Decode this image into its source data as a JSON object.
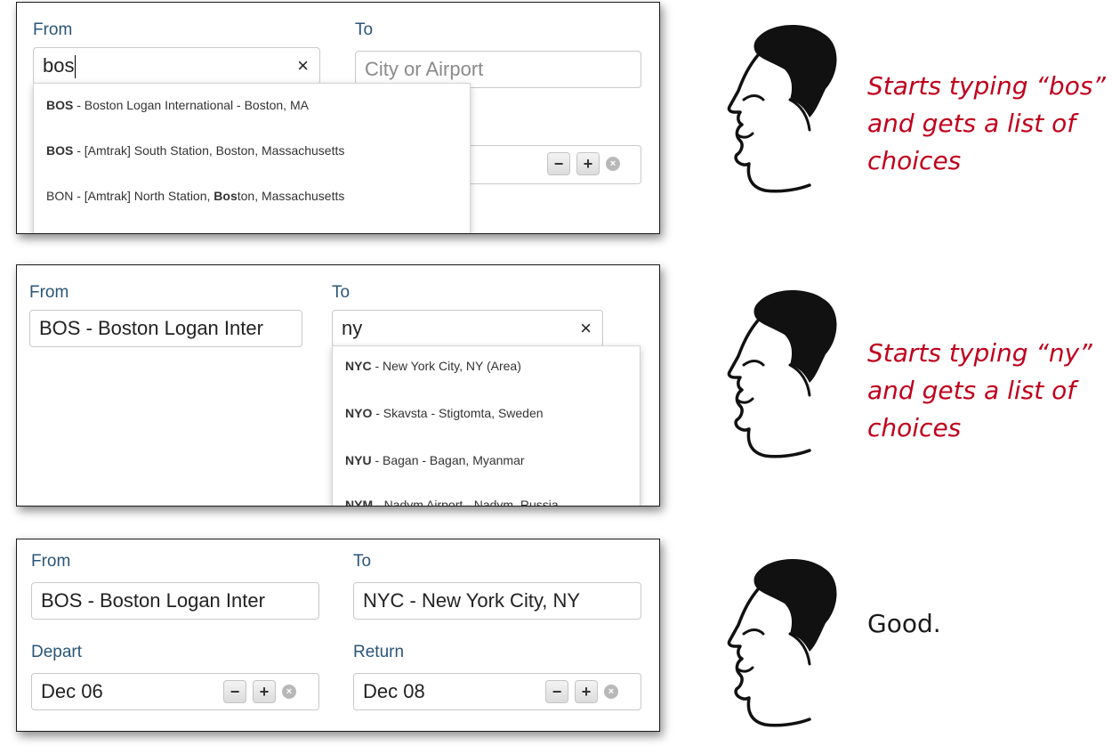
{
  "labels": {
    "from": "From",
    "to": "To",
    "depart": "Depart",
    "return": "Return"
  },
  "panel1": {
    "from_value": "bos",
    "to_placeholder": "City or Airport",
    "clear_icon": "×",
    "suggestions": [
      {
        "code": "BOS",
        "rest": " - Boston Logan International - Boston, MA"
      },
      {
        "code": "BOS",
        "rest": " - [Amtrak] South Station, Boston, Massachusetts"
      },
      {
        "pre": "BON - [Amtrak] North Station, ",
        "bold": "Bos",
        "post": "ton, Massachusetts"
      }
    ]
  },
  "panel2": {
    "from_value": "BOS - Boston Logan Inter",
    "to_value": "ny",
    "clear_icon": "×",
    "suggestions": [
      {
        "code": "NYC",
        "rest": " - New York City, NY (Area)"
      },
      {
        "code": "NYO",
        "rest": " - Skavsta - Stigtomta, Sweden"
      },
      {
        "code": "NYU",
        "rest": " - Bagan - Bagan, Myanmar"
      },
      {
        "code": "NYM",
        "rest": " - Nadym Airport - Nadym, Russia"
      }
    ]
  },
  "panel3": {
    "from_value": "BOS - Boston Logan Inter",
    "to_value": "NYC - New York City, NY",
    "depart_value": "Dec 06",
    "return_value": "Dec 08"
  },
  "stepper": {
    "minus": "−",
    "plus": "+",
    "clear": "×"
  },
  "captions": {
    "c1": [
      "Starts typing “bos”",
      "and gets a list of",
      "choices"
    ],
    "c2": [
      "Starts typing “ny”",
      "and gets a list of",
      "choices"
    ],
    "c3": [
      "Good."
    ]
  },
  "colors": {
    "label": "#2a5578",
    "caption_red": "#c0001c"
  },
  "icons": {
    "face": "face-profile-icon",
    "clear": "clear-icon",
    "minus": "minus-icon",
    "plus": "plus-icon"
  }
}
